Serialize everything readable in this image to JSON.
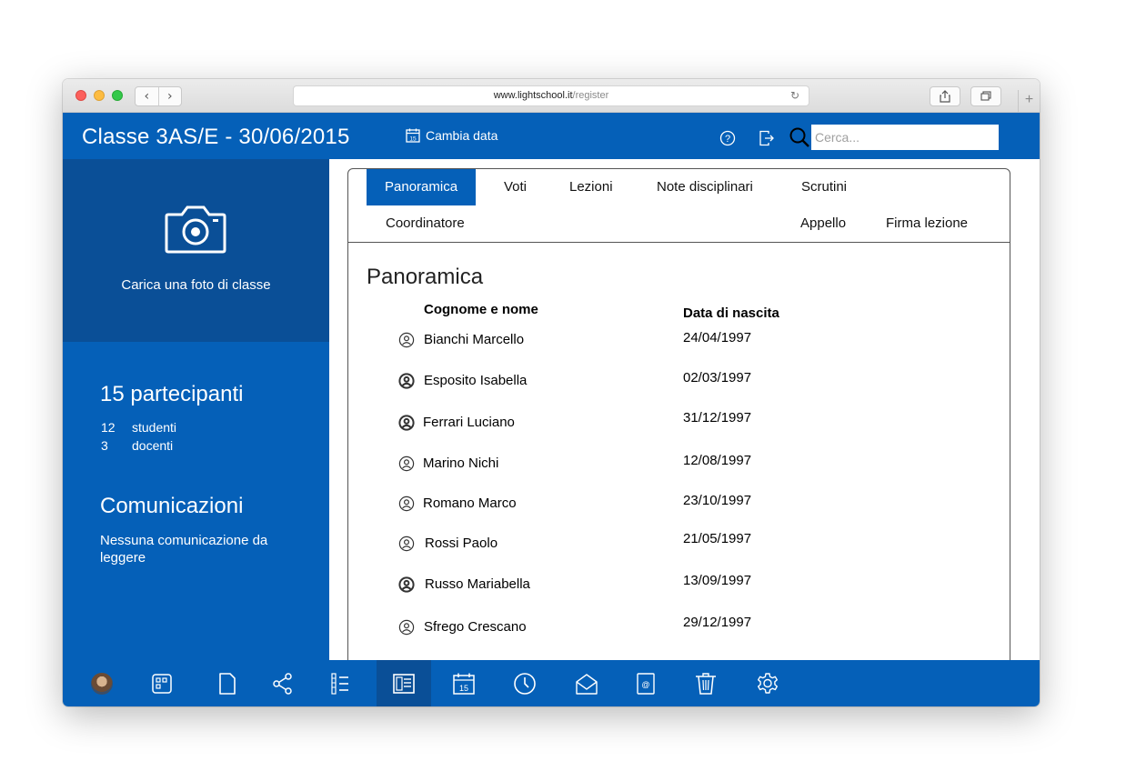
{
  "browser": {
    "url_domain": "www.lightschool.it",
    "url_path": "/register"
  },
  "header": {
    "class_title": "Classe 3AS/E - 30/06/2015",
    "change_date_label": "Cambia data",
    "search_placeholder": "Cerca..."
  },
  "sidebar": {
    "photo_label": "Carica una foto di classe",
    "participants_title": "15 partecipanti",
    "students_count": "12",
    "students_label": "studenti",
    "teachers_count": "3",
    "teachers_label": "docenti",
    "communications_title": "Comunicazioni",
    "communications_text": "Nessuna comunicazione da leggere"
  },
  "tabs": {
    "panoramica": "Panoramica",
    "voti": "Voti",
    "lezioni": "Lezioni",
    "note": "Note disciplinari",
    "scrutini": "Scrutini",
    "coordinatore": "Coordinatore",
    "appello": "Appello",
    "firma": "Firma lezione"
  },
  "overview": {
    "title": "Panoramica",
    "col_name": "Cognome e nome",
    "col_birth": "Data di nascita",
    "rows": [
      {
        "name": "Bianchi Marcello",
        "birth": "24/04/1997"
      },
      {
        "name": "Esposito Isabella",
        "birth": "02/03/1997"
      },
      {
        "name": "Ferrari Luciano",
        "birth": "31/12/1997"
      },
      {
        "name": "Marino Nichi",
        "birth": "12/08/1997"
      },
      {
        "name": "Romano Marco",
        "birth": "23/10/1997"
      },
      {
        "name": "Rossi Paolo",
        "birth": "21/05/1997"
      },
      {
        "name": "Russo Mariabella",
        "birth": "13/09/1997"
      },
      {
        "name": "Sfrego Crescano",
        "birth": "29/12/1997"
      }
    ]
  },
  "calendar_icon_day": "15",
  "colors": {
    "primary": "#0560b8",
    "primary_dark": "#0a4f97"
  }
}
